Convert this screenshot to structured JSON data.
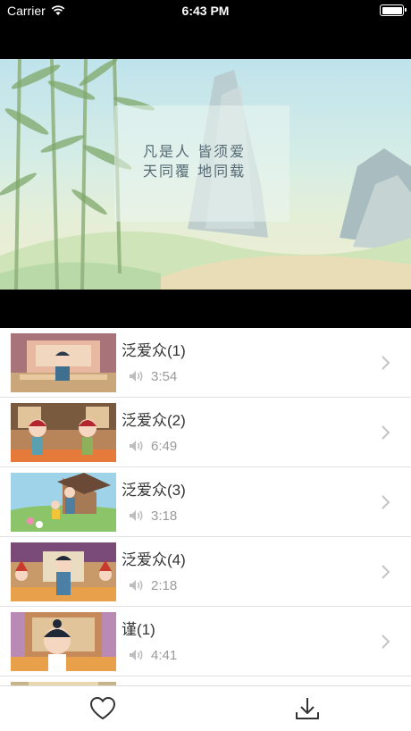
{
  "status_bar": {
    "carrier": "Carrier",
    "time": "6:43 PM"
  },
  "video": {
    "poem_line1": "凡是人 皆须爱",
    "poem_line2": "天同覆 地同载"
  },
  "episodes": [
    {
      "title": "泛爱众(1)",
      "duration": "3:54"
    },
    {
      "title": "泛爱众(2)",
      "duration": "6:49"
    },
    {
      "title": "泛爱众(3)",
      "duration": "3:18"
    },
    {
      "title": "泛爱众(4)",
      "duration": "2:18"
    },
    {
      "title": "谨(1)",
      "duration": "4:41"
    }
  ],
  "tabbar": {
    "icons": [
      "heart-icon",
      "download-icon"
    ]
  },
  "colors": {
    "accent": "#f3a18b",
    "icon": "#333333",
    "secondary_text": "#9a9a9a"
  }
}
